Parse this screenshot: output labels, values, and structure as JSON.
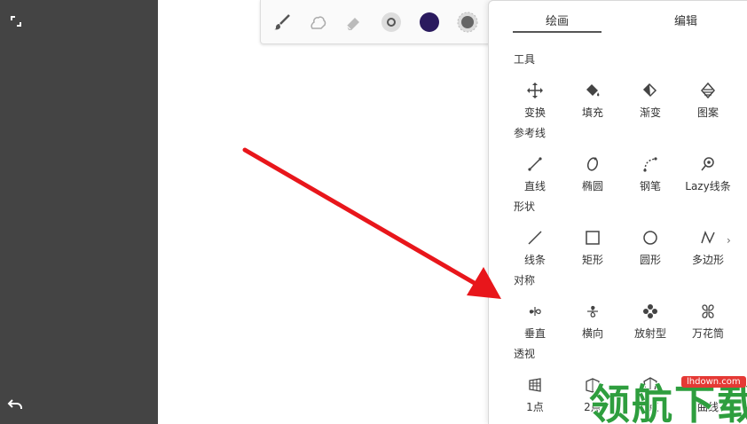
{
  "panel": {
    "tabs": [
      {
        "label": "绘画",
        "active": true
      },
      {
        "label": "编辑",
        "active": false
      }
    ],
    "sections": [
      {
        "title": "工具",
        "items": [
          {
            "label": "变换",
            "icon": "move-icon"
          },
          {
            "label": "填充",
            "icon": "fill-icon"
          },
          {
            "label": "渐变",
            "icon": "gradient-icon"
          },
          {
            "label": "图案",
            "icon": "pattern-icon"
          }
        ]
      },
      {
        "title": "参考线",
        "items": [
          {
            "label": "直线",
            "icon": "ruler-line-icon"
          },
          {
            "label": "椭圆",
            "icon": "ellipse-guide-icon"
          },
          {
            "label": "钢笔",
            "icon": "pen-path-icon"
          },
          {
            "label": "Lazy线条",
            "icon": "lazy-line-icon"
          }
        ]
      },
      {
        "title": "形状",
        "items": [
          {
            "label": "线条",
            "icon": "line-shape-icon"
          },
          {
            "label": "矩形",
            "icon": "rectangle-icon"
          },
          {
            "label": "圆形",
            "icon": "circle-icon"
          },
          {
            "label": "多边形",
            "icon": "polygon-icon"
          }
        ]
      },
      {
        "title": "对称",
        "items": [
          {
            "label": "垂直",
            "icon": "vertical-symmetry-icon"
          },
          {
            "label": "横向",
            "icon": "horizontal-symmetry-icon"
          },
          {
            "label": "放射型",
            "icon": "radial-symmetry-icon"
          },
          {
            "label": "万花筒",
            "icon": "kaleidoscope-icon"
          }
        ]
      },
      {
        "title": "透视",
        "items": [
          {
            "label": "1点",
            "icon": "one-point-perspective-icon"
          },
          {
            "label": "2点",
            "icon": "two-point-perspective-icon"
          },
          {
            "label": "3点",
            "icon": "three-point-perspective-icon"
          },
          {
            "label": "曲线",
            "icon": "curvilinear-perspective-icon"
          }
        ]
      }
    ]
  },
  "toolbar": {
    "items": [
      "brush-icon",
      "smudge-icon",
      "eraser-icon",
      "brush-size-icon",
      "color-swatch-icon",
      "opacity-icon"
    ],
    "current_color": "#2a1a5e"
  },
  "left_rail": {
    "items": [
      "fullscreen-icon",
      "undo-icon"
    ]
  },
  "annotation": {
    "arrow_color": "#e8161b"
  },
  "watermark": {
    "text": "领航下载",
    "site": "lhdown.com",
    "text_color": "#2e9e3e",
    "badge_color": "#e53935"
  }
}
